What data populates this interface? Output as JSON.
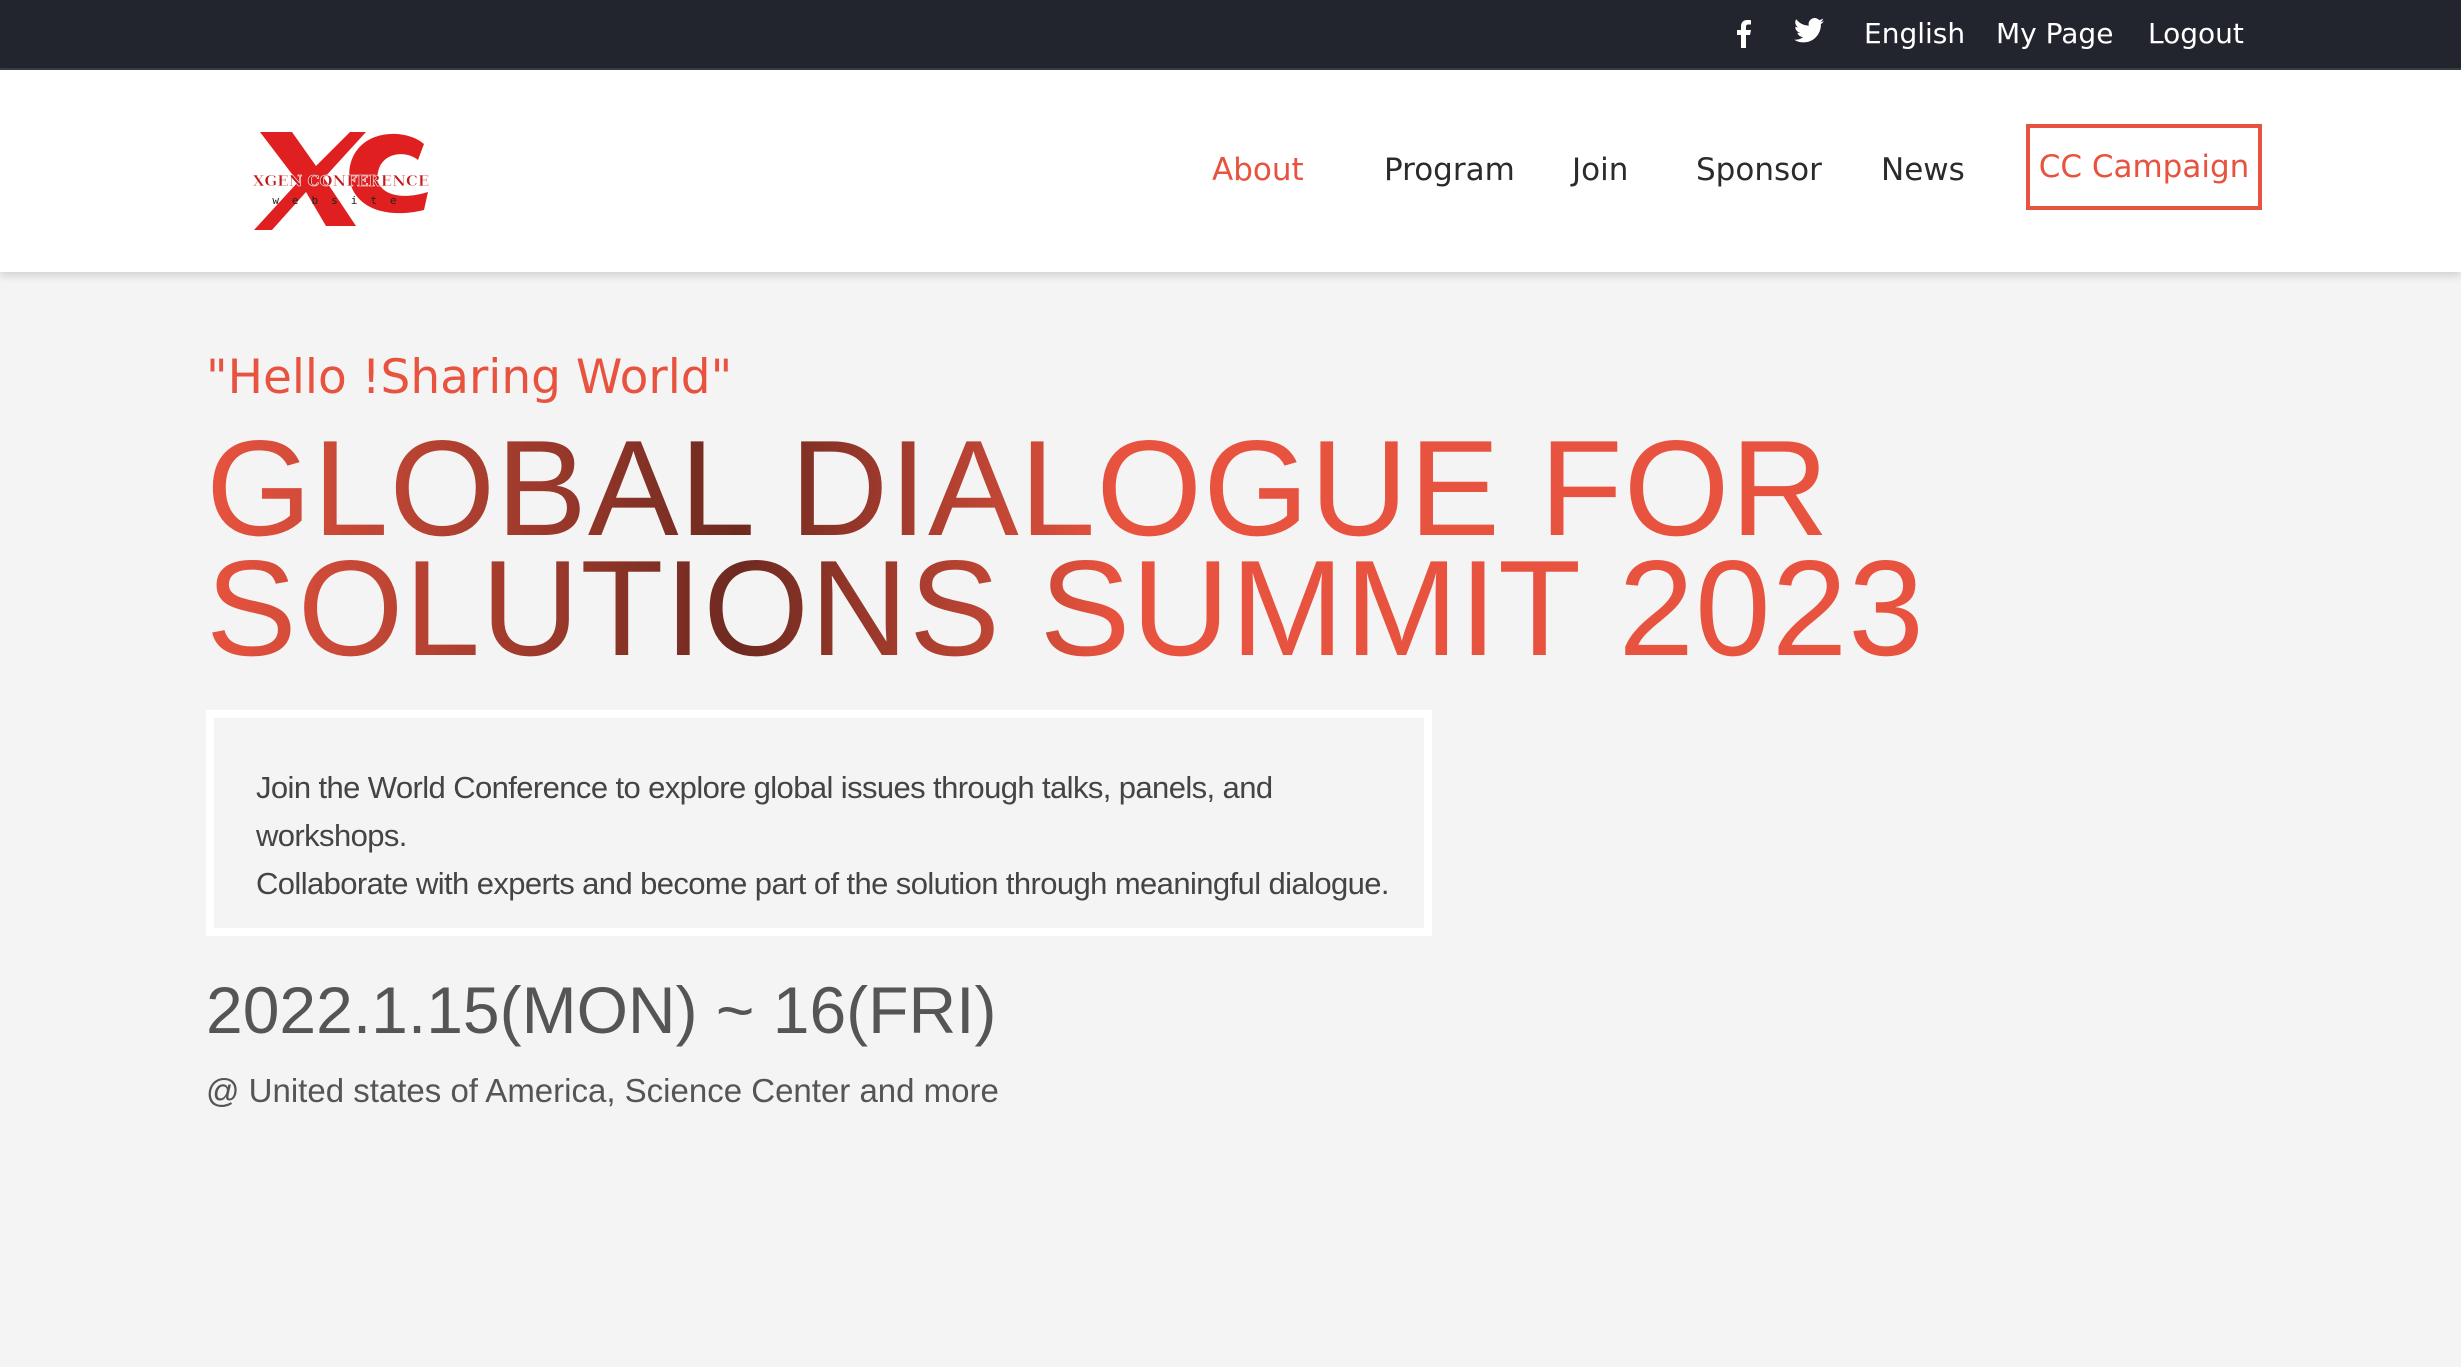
{
  "topbar": {
    "facebook_icon": "facebook-icon",
    "twitter_icon": "twitter-icon",
    "language": "English",
    "my_page": "My Page",
    "logout": "Logout"
  },
  "logo": {
    "mark": "XC",
    "name": "XGEN CONFERENCE",
    "sub": "website"
  },
  "nav": {
    "about": "About",
    "program": "Program",
    "join": "Join",
    "sponsor": "Sponsor",
    "news": "News",
    "campaign": "CC Campaign"
  },
  "hero": {
    "tagline": "\"Hello !Sharing World\"",
    "headline_line1": "GLOBAL DIALOGUE FOR",
    "headline_line2": "SOLUTIONS SUMMIT 2023",
    "description_line1": "Join the World Conference to explore global issues through talks, panels, and workshops.",
    "description_line2": "Collaborate with experts and become part of the solution through meaningful dialogue.",
    "date": "2022.1.15(MON) ~ 16(FRI)",
    "venue": "@ United states of America, Science Center and more"
  },
  "colors": {
    "accent": "#e8533f",
    "accent_dark": "#6e2a20",
    "topbar_bg": "#22252e",
    "page_bg": "#f4f4f4"
  }
}
